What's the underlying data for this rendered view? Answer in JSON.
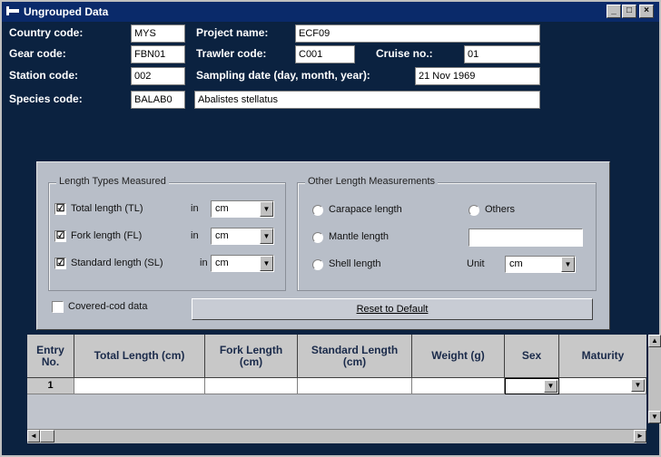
{
  "window": {
    "title": "Ungrouped Data",
    "minimize": "_",
    "maximize": "□",
    "close": "×"
  },
  "header": {
    "country_code_label": "Country code:",
    "country_code_value": "MYS",
    "project_name_label": "Project name:",
    "project_name_value": "ECF09",
    "gear_code_label": "Gear code:",
    "gear_code_value": "FBN01",
    "trawler_code_label": "Trawler code:",
    "trawler_code_value": "C001",
    "cruise_no_label": "Cruise no.:",
    "cruise_no_value": "01",
    "station_code_label": "Station code:",
    "station_code_value": "002",
    "sampling_date_label": "Sampling date (day, month, year):",
    "sampling_date_value": "21 Nov 1969",
    "species_code_label": "Species code:",
    "species_code_value": "BALAB0",
    "species_name_value": "Abalistes stellatus"
  },
  "length_types": {
    "title": "Length Types Measured",
    "in_label": "in",
    "items": [
      {
        "label": "Total length (TL)",
        "checked": "☑",
        "unit": "cm"
      },
      {
        "label": "Fork length (FL)",
        "checked": "☑",
        "unit": "cm"
      },
      {
        "label": "Standard length (SL)",
        "checked": "☑",
        "unit": "cm"
      }
    ]
  },
  "other_lengths": {
    "title": "Other Length Measurements",
    "carapace": "Carapace length",
    "mantle": "Mantle length",
    "shell": "Shell length",
    "others": "Others",
    "unit_label": "Unit",
    "unit_value": "cm"
  },
  "covered_cod": {
    "label": "Covered-cod data"
  },
  "reset_button": "Reset to Default",
  "grid": {
    "columns": [
      "Entry No.",
      "Total Length (cm)",
      "Fork Length (cm)",
      "Standard Length (cm)",
      "Weight (g)",
      "Sex",
      "Maturity"
    ],
    "rows": [
      {
        "entry": "1"
      }
    ]
  },
  "icons": {
    "dropdown_arrow": "▼",
    "scroll_up": "▲",
    "scroll_down": "▼",
    "scroll_left": "◄",
    "scroll_right": "►"
  }
}
